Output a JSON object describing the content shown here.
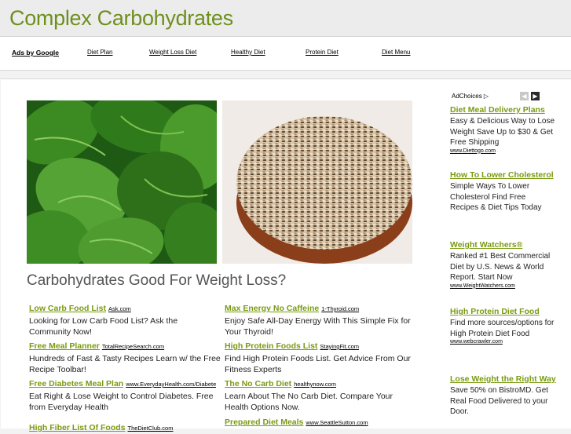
{
  "header": {
    "title": "Complex Carbohydrates"
  },
  "adbar": {
    "ads_by": "Ads by Google",
    "links": [
      "Diet Plan",
      "Weight Loss Diet",
      "Healthy Diet",
      "Protein Diet",
      "Diet Menu"
    ]
  },
  "main": {
    "headline": "Carbohydrates Good For Weight Loss?",
    "ads": [
      {
        "title": "Low Carb Food List",
        "domain": "Ask.com",
        "desc": "Looking for Low Carb Food List? Ask the Community Now!"
      },
      {
        "title": "Max Energy No Caffeine",
        "domain": "1-Thyroid.com",
        "desc": "Enjoy Safe All-Day Energy With This Simple Fix for Your Thyroid!"
      },
      {
        "title": "Free Meal Planner",
        "domain": "TotalRecipeSearch.com",
        "desc": "Hundreds of Fast & Tasty Recipes Learn w/ the Free Recipe Toolbar!"
      },
      {
        "title": "High Protein Foods List",
        "domain": "StayingFit.com",
        "desc": "Find High Protein Foods List. Get Advice From Our Fitness Experts"
      },
      {
        "title": "Free Diabetes Meal Plan",
        "domain": "www.EverydayHealth.com/Diabetes",
        "desc": "Eat Right & Lose Weight to Control Diabetes. Free from Everyday Health"
      },
      {
        "title": "The No Carb Diet",
        "domain": "healthynow.com",
        "desc": "Learn About The No Carb Diet. Compare Your Health Options Now."
      },
      {
        "title": "High Fiber List Of Foods",
        "domain": "TheDietClub.com",
        "desc": ""
      },
      {
        "title": "Prepared Diet Meals",
        "domain": "www.SeattleSutton.com",
        "desc": ""
      }
    ]
  },
  "sidebar": {
    "adchoices": "AdChoices",
    "ads": [
      {
        "title": "Diet Meal Delivery Plans",
        "desc": "Easy & Delicious Way to Lose Weight Save Up to $30 & Get Free Shipping",
        "domain": "www.Diettogo.com"
      },
      {
        "title": "How To Lower Cholesterol",
        "desc": "Simple Ways To Lower Cholesterol Find Free Recipes & Diet Tips Today",
        "domain": ""
      },
      {
        "title": "Weight Watchers®",
        "desc": "Ranked #1 Best Commercial Diet by U.S. News & World Report. Start Now",
        "domain": "www.WeightWatchers.com"
      },
      {
        "title": "High Protein Diet Food",
        "desc": "Find more sources/options for High Protein Diet Food",
        "domain": "www.webcrawler.com"
      },
      {
        "title": "Lose Weight the Right Way",
        "desc": "Save 50% on BistroMD. Get Real Food Delivered to your Door.",
        "domain": ""
      }
    ]
  },
  "colors": {
    "accent": "#6f8f1c",
    "link": "#7a9a12"
  }
}
